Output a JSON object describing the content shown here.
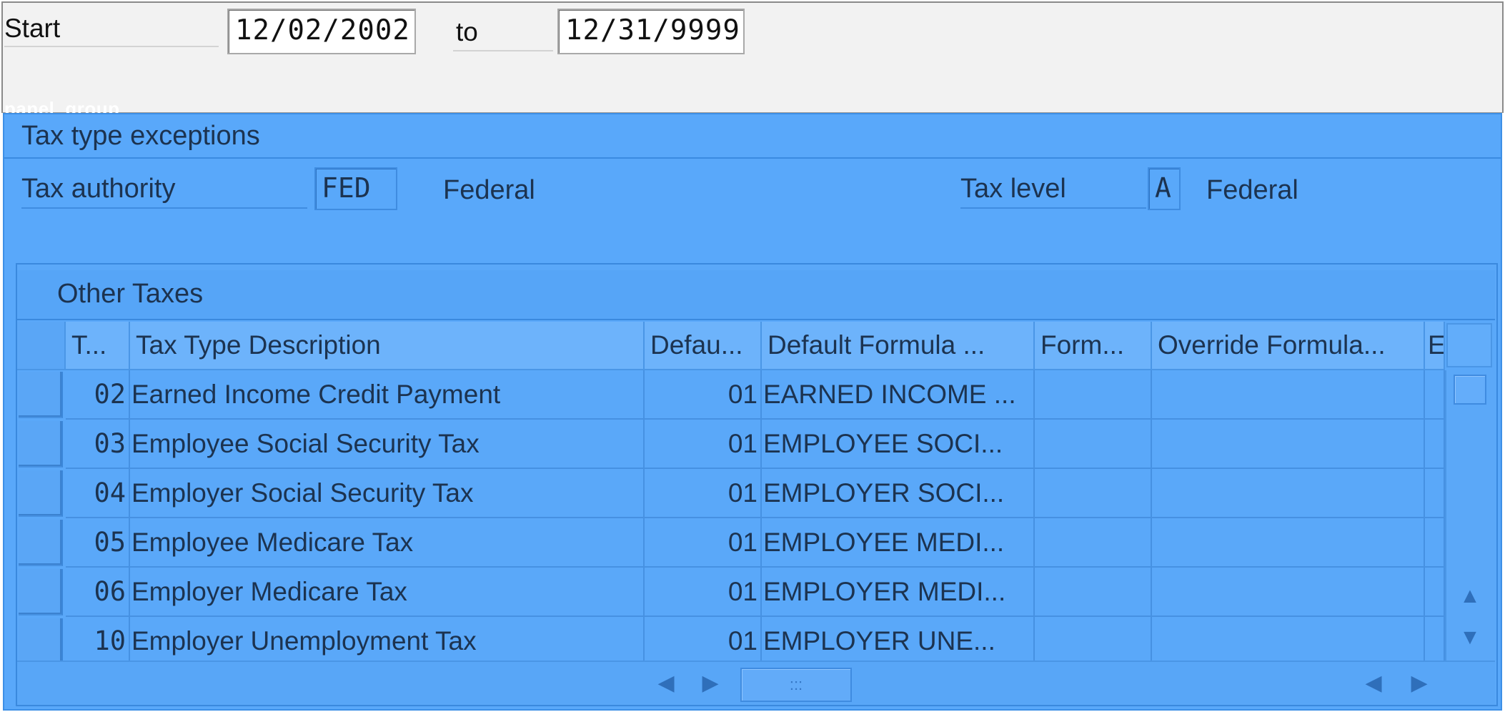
{
  "date_range": {
    "start_label": "Start",
    "start_value": "12/02/2002",
    "to_label": "to",
    "end_value": "12/31/9999"
  },
  "overlay_tag": "panel_group",
  "panel": {
    "title": "Tax type exceptions",
    "tax_authority_label": "Tax authority",
    "tax_authority_code": "FED",
    "tax_authority_name": "Federal",
    "tax_level_label": "Tax level",
    "tax_level_code": "A",
    "tax_level_name": "Federal"
  },
  "table": {
    "group_title": "Other Taxes",
    "columns": [
      "T...",
      "Tax Type Description",
      "Defau...",
      "Default Formula ...",
      "Form...",
      "Override Formula...",
      "E"
    ],
    "rows": [
      {
        "code": "02",
        "description": "Earned Income Credit Payment",
        "default": "01",
        "default_formula": "EARNED INCOME ..."
      },
      {
        "code": "03",
        "description": "Employee Social Security Tax",
        "default": "01",
        "default_formula": "EMPLOYEE SOCI..."
      },
      {
        "code": "04",
        "description": "Employer Social Security Tax",
        "default": "01",
        "default_formula": "EMPLOYER SOCI..."
      },
      {
        "code": "05",
        "description": "Employee Medicare Tax",
        "default": "01",
        "default_formula": "EMPLOYEE MEDI..."
      },
      {
        "code": "06",
        "description": "Employer Medicare Tax",
        "default": "01",
        "default_formula": "EMPLOYER MEDI..."
      },
      {
        "code": "10",
        "description": "Employer Unemployment Tax",
        "default": "01",
        "default_formula": "EMPLOYER UNE..."
      }
    ]
  },
  "scrollbars": {
    "up_icon": "triangle-up",
    "down_icon": "triangle-down",
    "left_icon": "triangle-left",
    "right_icon": "triangle-right",
    "grip_icon": "grip-dots",
    "grip_text": ":::"
  },
  "colors": {
    "panel_bg": "#59a8fa",
    "top_bg": "#f2f2f2"
  }
}
